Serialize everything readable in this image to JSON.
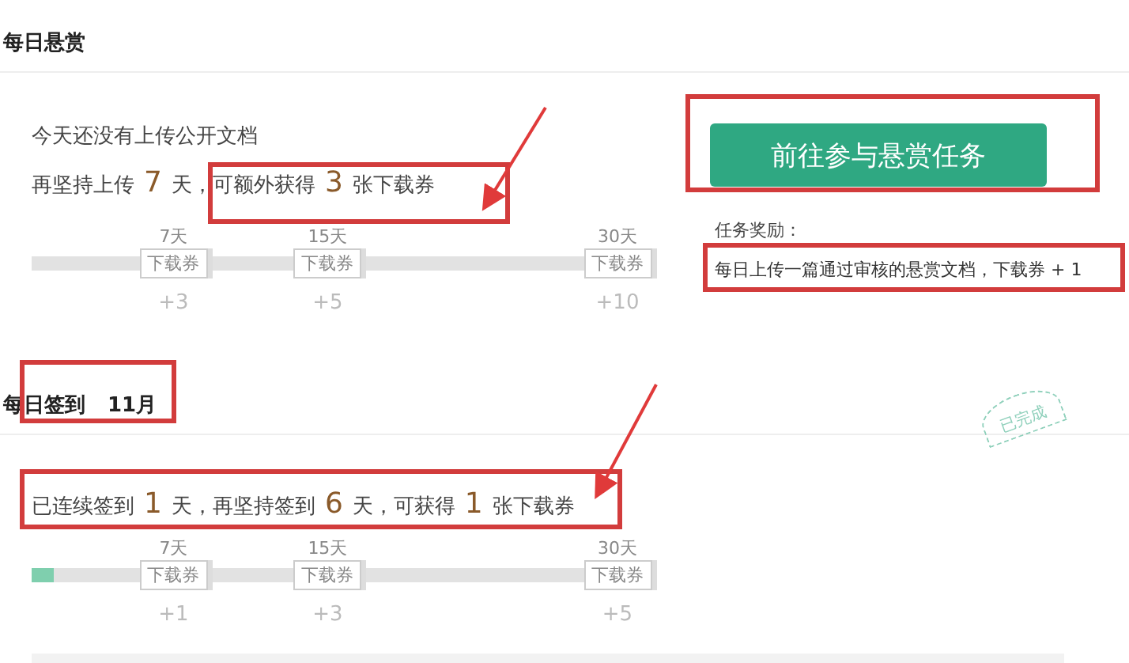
{
  "reward": {
    "title": "每日悬赏",
    "status": "今天还没有上传公开文档",
    "sentence": [
      {
        "kind": "text",
        "text": "再坚持上传"
      },
      {
        "kind": "num",
        "text": "7"
      },
      {
        "kind": "text",
        "text": "天，可额外获得"
      },
      {
        "kind": "num",
        "text": "3"
      },
      {
        "kind": "text",
        "text": "张下载券"
      }
    ],
    "progress": {
      "milestones": [
        {
          "day": "7天",
          "tag": "下载券",
          "bonus": "+3"
        },
        {
          "day": "15天",
          "tag": "下载券",
          "bonus": "+5"
        },
        {
          "day": "30天",
          "tag": "下载券",
          "bonus": "+10"
        }
      ]
    },
    "button": "前往参与悬赏任务",
    "task_label": "任务奖励：",
    "task_text": "每日上传一篇通过审核的悬赏文档，下载券 + 1"
  },
  "signin": {
    "title": "每日签到",
    "month": "11月",
    "stamp": "已完成",
    "sentence": [
      {
        "kind": "text",
        "text": "已连续签到"
      },
      {
        "kind": "num",
        "text": "1"
      },
      {
        "kind": "text",
        "text": "天，再坚持签到"
      },
      {
        "kind": "num",
        "text": "6"
      },
      {
        "kind": "text",
        "text": "天，可获得"
      },
      {
        "kind": "num",
        "text": "1"
      },
      {
        "kind": "text",
        "text": "张下载券"
      }
    ],
    "progress": {
      "level": 0.035,
      "milestones": [
        {
          "day": "7天",
          "tag": "下载券",
          "bonus": "+1"
        },
        {
          "day": "15天",
          "tag": "下载券",
          "bonus": "+3"
        },
        {
          "day": "30天",
          "tag": "下载券",
          "bonus": "+5"
        }
      ]
    }
  }
}
